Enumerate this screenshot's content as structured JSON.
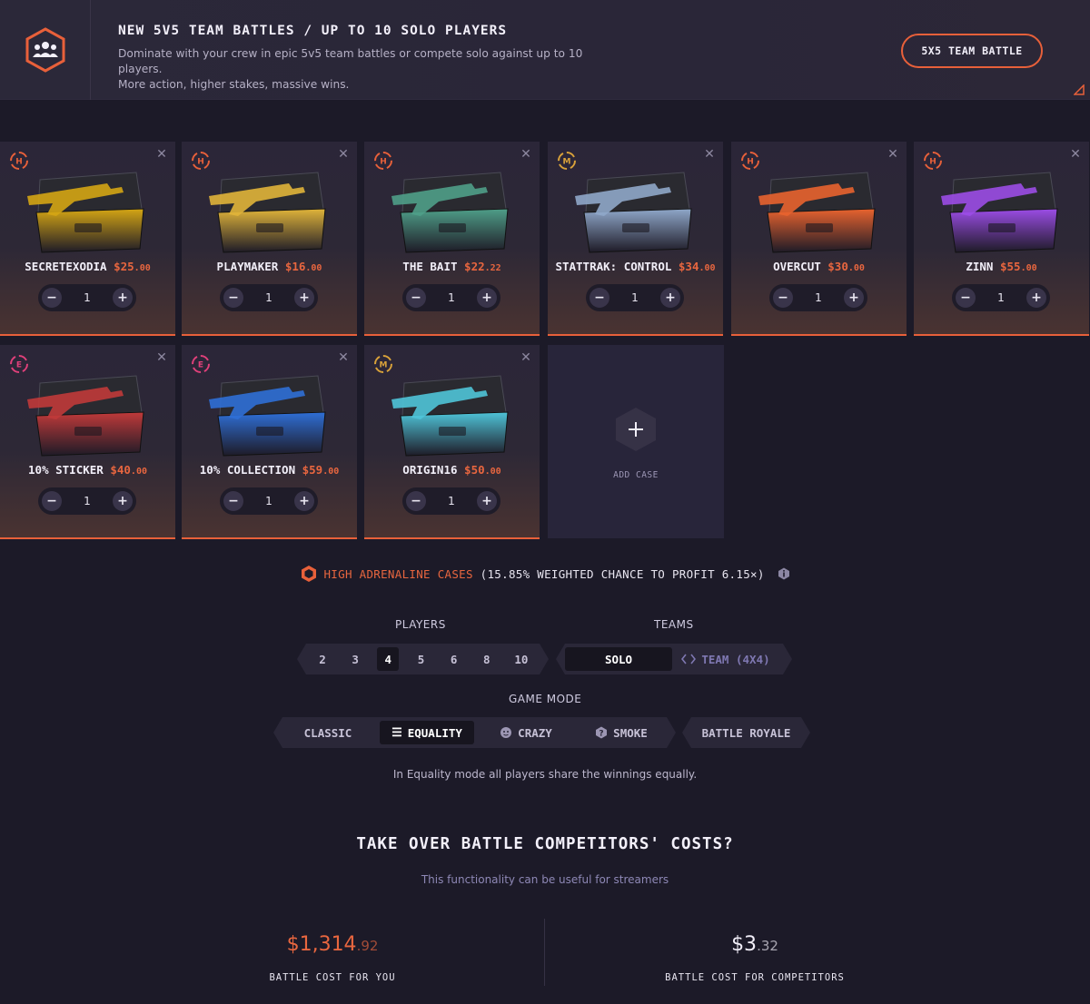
{
  "banner": {
    "title": "NEW 5V5 TEAM BATTLES / UP TO 10 SOLO PLAYERS",
    "desc_line1": "Dominate with your crew in epic 5v5 team battles or compete solo against up to 10 players.",
    "desc_line2": "More action, higher stakes, massive wins.",
    "button_label": "5X5 TEAM BATTLE",
    "icon": "team-icon"
  },
  "cases": [
    {
      "badge": "H",
      "name": "SECRETEXODIA",
      "price": "$25",
      "cents": ".00",
      "qty": "1",
      "accent": "#d4a514"
    },
    {
      "badge": "H",
      "name": "PLAYMAKER",
      "price": "$16",
      "cents": ".00",
      "qty": "1",
      "accent": "#e0b43a"
    },
    {
      "badge": "H",
      "name": "THE BAIT",
      "price": "$22",
      "cents": ".22",
      "qty": "1",
      "accent": "#4f9e88"
    },
    {
      "badge": "M",
      "name": "STATTRAK: CONTROL",
      "price": "$34",
      "cents": ".00",
      "qty": "1",
      "accent": "#8fa7c9"
    },
    {
      "badge": "H",
      "name": "OVERCUT",
      "price": "$30",
      "cents": ".00",
      "qty": "1",
      "accent": "#e8632f"
    },
    {
      "badge": "H",
      "name": "ZINN",
      "price": "$55",
      "cents": ".00",
      "qty": "1",
      "accent": "#9b4de6"
    },
    {
      "badge": "E",
      "name": "10% STICKER",
      "price": "$40",
      "cents": ".00",
      "qty": "1",
      "accent": "#c03a3a"
    },
    {
      "badge": "E",
      "name": "10% COLLECTION",
      "price": "$59",
      "cents": ".00",
      "qty": "1",
      "accent": "#2f6fd6"
    },
    {
      "badge": "M",
      "name": "ORIGIN16",
      "price": "$50",
      "cents": ".00",
      "qty": "1",
      "accent": "#4fc4d8"
    }
  ],
  "add_case": {
    "label": "ADD CASE"
  },
  "info": {
    "highlight": "HIGH ADRENALINE CASES",
    "rest": " (15.85% WEIGHTED CHANCE TO PROFIT 6.15×)"
  },
  "players": {
    "label": "PLAYERS",
    "options": [
      "2",
      "3",
      "4",
      "5",
      "6",
      "8",
      "10"
    ],
    "selected": "4"
  },
  "teams": {
    "label": "TEAMS",
    "options": [
      "SOLO",
      "TEAM (4X4)"
    ],
    "selected": "SOLO"
  },
  "game_mode": {
    "label": "GAME MODE",
    "options": [
      "CLASSIC",
      "EQUALITY",
      "CRAZY",
      "SMOKE",
      "BATTLE ROYALE"
    ],
    "selected": "EQUALITY",
    "description": "In Equality mode all players share the winnings equally."
  },
  "takeover": {
    "title": "TAKE OVER BATTLE COMPETITORS' COSTS?",
    "subtitle": "This functionality can be useful for streamers"
  },
  "costs": {
    "you_main": "$1,314",
    "you_dec": ".92",
    "you_label": "BATTLE COST FOR YOU",
    "competitors_main": "$3",
    "competitors_dec": ".32",
    "competitors_label": "BATTLE COST FOR COMPETITORS"
  },
  "colors": {
    "accent": "#e8603a",
    "background": "#1c1a28",
    "card": "#2b2638"
  }
}
